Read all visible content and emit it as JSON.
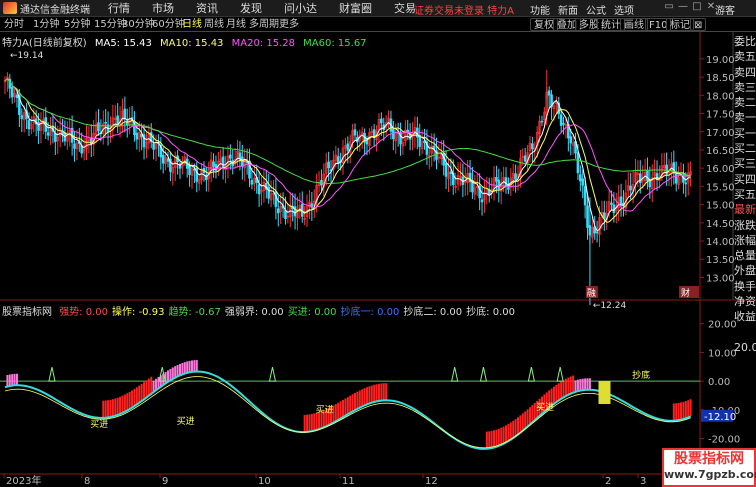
{
  "app": {
    "title": "通达信金融终端"
  },
  "menu": [
    "行情",
    "市场",
    "资讯",
    "发现",
    "问小达",
    "财富圈",
    "交易"
  ],
  "notice": "证券交易未登录  特力A",
  "right_menu": [
    "功能",
    "新面",
    "公式",
    "选项"
  ],
  "window_controls": [
    "▭",
    "—",
    "□",
    "✕"
  ],
  "guest_label": "游客",
  "toolbar": {
    "periods": [
      "分时",
      "1分钟",
      "5分钟",
      "15分钟",
      "30分钟",
      "60分钟",
      "日线",
      "周线",
      "月线",
      "多周期",
      "更多"
    ],
    "active_period": "日线",
    "right_tools": [
      "复权",
      "叠加",
      "多股",
      "统计",
      "画线",
      "F10",
      "标记",
      "⊠"
    ]
  },
  "stock_header": {
    "name": "特力A(日线前复权)",
    "ma5": "MA5: 15.43",
    "ma10": "MA10: 15.43",
    "ma20": "MA20: 15.28",
    "ma60": "MA60: 15.67"
  },
  "indicator_header": {
    "name": "股票指标网",
    "items": [
      {
        "text": "强势: 0.00",
        "color": "#ff4d4d"
      },
      {
        "text": "操作: -0.93",
        "color": "#ffff66"
      },
      {
        "text": "趋势: -0.67",
        "color": "#44dd44"
      },
      {
        "text": "强弱界: 0.00",
        "color": "#dddddd"
      },
      {
        "text": "买进: 0.00",
        "color": "#44dd44"
      },
      {
        "text": "抄底一: 0.00",
        "color": "#3377ff"
      },
      {
        "text": "抄底二: 0.00",
        "color": "#dddddd"
      },
      {
        "text": "抄底: 0.00",
        "color": "#dddddd"
      }
    ]
  },
  "sidebar": [
    {
      "label": "委比",
      "tone": ""
    },
    {
      "label": "卖五",
      "tone": ""
    },
    {
      "label": "卖四",
      "tone": ""
    },
    {
      "label": "卖三",
      "tone": ""
    },
    {
      "label": "卖二",
      "tone": ""
    },
    {
      "label": "卖一",
      "tone": ""
    },
    {
      "label": "买一",
      "tone": ""
    },
    {
      "label": "买二",
      "tone": ""
    },
    {
      "label": "买三",
      "tone": ""
    },
    {
      "label": "买四",
      "tone": ""
    },
    {
      "label": "买五",
      "tone": ""
    },
    {
      "label": "最新",
      "tone": "red"
    },
    {
      "label": "涨跌",
      "tone": ""
    },
    {
      "label": "涨幅",
      "tone": ""
    },
    {
      "label": "总量",
      "tone": ""
    },
    {
      "label": "外盘",
      "tone": ""
    },
    {
      "label": "换手",
      "tone": ""
    },
    {
      "label": "净资",
      "tone": ""
    },
    {
      "label": "收益",
      "tone": ""
    },
    {
      "label": "",
      "tone": ""
    },
    {
      "label": "20.00",
      "tone": ""
    }
  ],
  "chart_data": [
    {
      "type": "candlestick",
      "price_axis_labels": [
        "19.00",
        "18.50",
        "18.00",
        "17.50",
        "17.00",
        "16.50",
        "16.00",
        "15.50",
        "15.00",
        "14.50",
        "14.00",
        "13.50",
        "13.00"
      ],
      "ylim": [
        12.6,
        19.3
      ],
      "annotations": {
        "high": "19.14",
        "low": "12.24"
      },
      "markers": [
        "融",
        "财"
      ],
      "ma_colors": {
        "ma5": "#ffffff",
        "ma10": "#ffff66",
        "ma20": "#ff55ff",
        "ma60": "#44dd44"
      },
      "up_color": "#ff3333",
      "down_color": "#33ddff"
    },
    {
      "type": "indicator",
      "axis_labels": [
        "20.00",
        "10.00",
        "0.00",
        "-10.00",
        "-20.00",
        "-30.00"
      ],
      "ylim": [
        -31,
        22
      ],
      "current_value": "-12.10",
      "text_labels": [
        "买进",
        "买进",
        "买进",
        "抄底",
        "买进"
      ],
      "x_labels": [
        "2023年",
        "8",
        "9",
        "10",
        "11",
        "12",
        "2",
        "3"
      ]
    }
  ]
}
